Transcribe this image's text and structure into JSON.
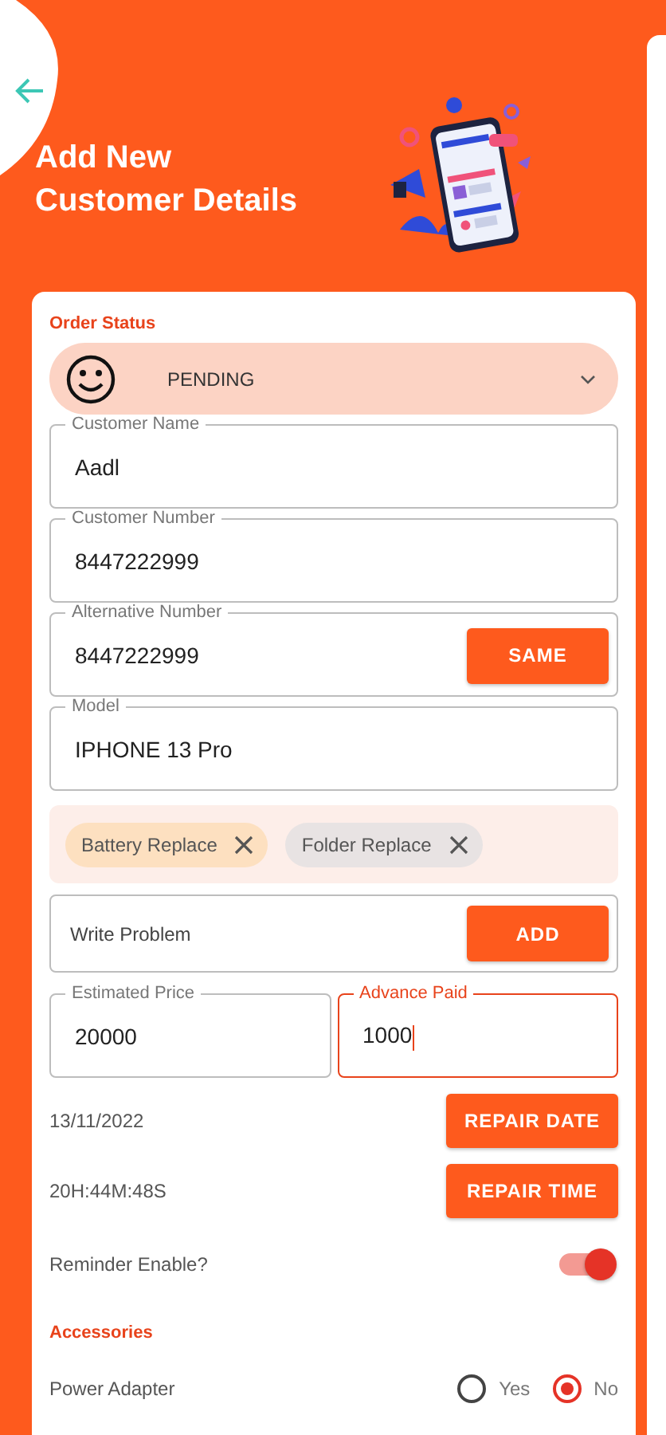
{
  "header": {
    "title_lines": [
      "Add New",
      "Customer Details"
    ]
  },
  "order_status": {
    "label": "Order Status",
    "value": "PENDING"
  },
  "fields": [
    {
      "label": "Customer Name",
      "value": "Aadl"
    },
    {
      "label": "Customer Number",
      "value": "8447222999"
    },
    {
      "label": "Alternative Number",
      "value": "8447222999",
      "button": "SAME"
    },
    {
      "label": "Model",
      "value": "IPHONE 13 Pro"
    }
  ],
  "chips": [
    {
      "label": "Battery Replace",
      "color": "#fde0c0"
    },
    {
      "label": "Folder Replace",
      "color": "#e8e3e3"
    }
  ],
  "problem_input": {
    "placeholder": "Write Problem",
    "button": "ADD"
  },
  "price_fields": [
    {
      "label": "Estimated Price",
      "value": "20000",
      "focused": false
    },
    {
      "label": "Advance Paid",
      "value": "1000",
      "focused": true
    }
  ],
  "schedule": [
    {
      "value": "13/11/2022",
      "button": "REPAIR DATE"
    },
    {
      "value": "20H:44M:48S",
      "button": "REPAIR TIME"
    }
  ],
  "reminder": {
    "label": "Reminder Enable?",
    "on": true
  },
  "accessories": {
    "title": "Accessories",
    "items": [
      {
        "label": "Power Adapter",
        "options": [
          {
            "label": "Yes",
            "selected": false
          },
          {
            "label": "No",
            "selected": true
          }
        ]
      }
    ]
  }
}
